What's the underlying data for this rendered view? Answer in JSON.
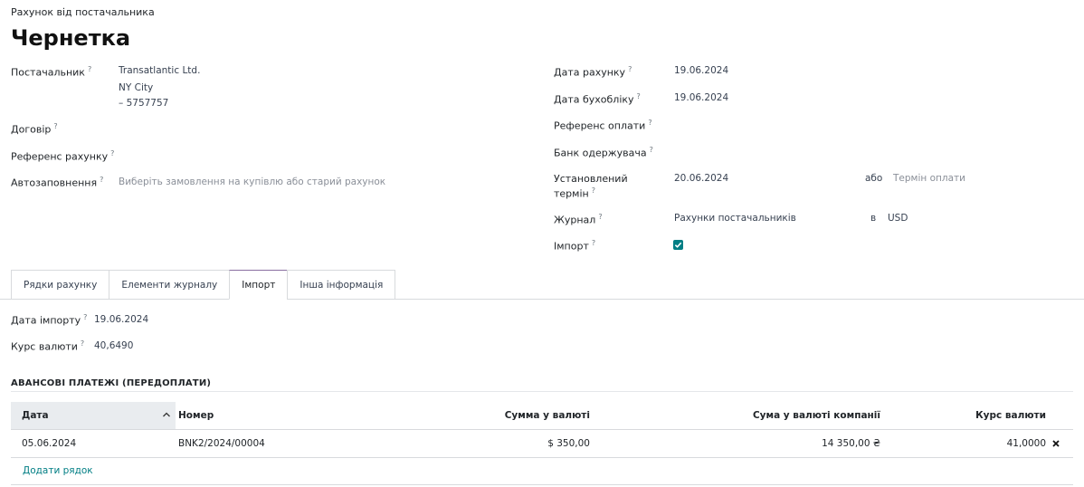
{
  "breadcrumb": "Рахунок від постачальника",
  "title": "Чернетка",
  "left_fields": {
    "vendor_label": "Постачальник",
    "vendor_lines": [
      "Transatlantic Ltd.",
      "NY City",
      "– 5757757"
    ],
    "contract_label": "Договір",
    "bill_ref_label": "Референс рахунку",
    "autofill_label": "Автозаповнення",
    "autofill_placeholder": "Виберіть замовлення на купівлю або старий рахунок"
  },
  "right_fields": {
    "bill_date_label": "Дата рахунку",
    "bill_date": "19.06.2024",
    "acc_date_label": "Дата бухобліку",
    "acc_date": "19.06.2024",
    "payment_ref_label": "Референс оплати",
    "bank_label": "Банк одержувача",
    "due_label_1": "Установлений",
    "due_label_2": "термін",
    "due_date": "20.06.2024",
    "or_text": "або",
    "terms_placeholder": "Термін оплати",
    "journal_label": "Журнал",
    "journal_value": "Рахунки постачальників",
    "in_text": "в",
    "currency": "USD",
    "import_label": "Імпорт",
    "import_checked": true
  },
  "tabs": [
    {
      "label": "Рядки рахунку",
      "active": false
    },
    {
      "label": "Елементи журналу",
      "active": false
    },
    {
      "label": "Імпорт",
      "active": true
    },
    {
      "label": "Інша інформація",
      "active": false
    }
  ],
  "import_tab": {
    "import_date_label": "Дата імпорту",
    "import_date": "19.06.2024",
    "rate_label": "Курс валюти",
    "rate": "40,6490"
  },
  "prepayments": {
    "title": "АВАНСОВІ ПЛАТЕЖІ (ПЕРЕДОПЛАТИ)",
    "columns": {
      "date": "Дата",
      "number": "Номер",
      "amount_currency": "Сумма у валюті",
      "amount_company": "Сума у валюті компанії",
      "rate": "Курс валюти"
    },
    "rows": [
      {
        "date": "05.06.2024",
        "number": "BNK2/2024/00004",
        "amount_currency": "$ 350,00",
        "amount_company": "14 350,00 ₴",
        "rate": "41,0000"
      }
    ],
    "add_line": "Додати рядок"
  },
  "colors": {
    "accent": "#017e84",
    "tab_active_border": "#8a6fa0"
  }
}
